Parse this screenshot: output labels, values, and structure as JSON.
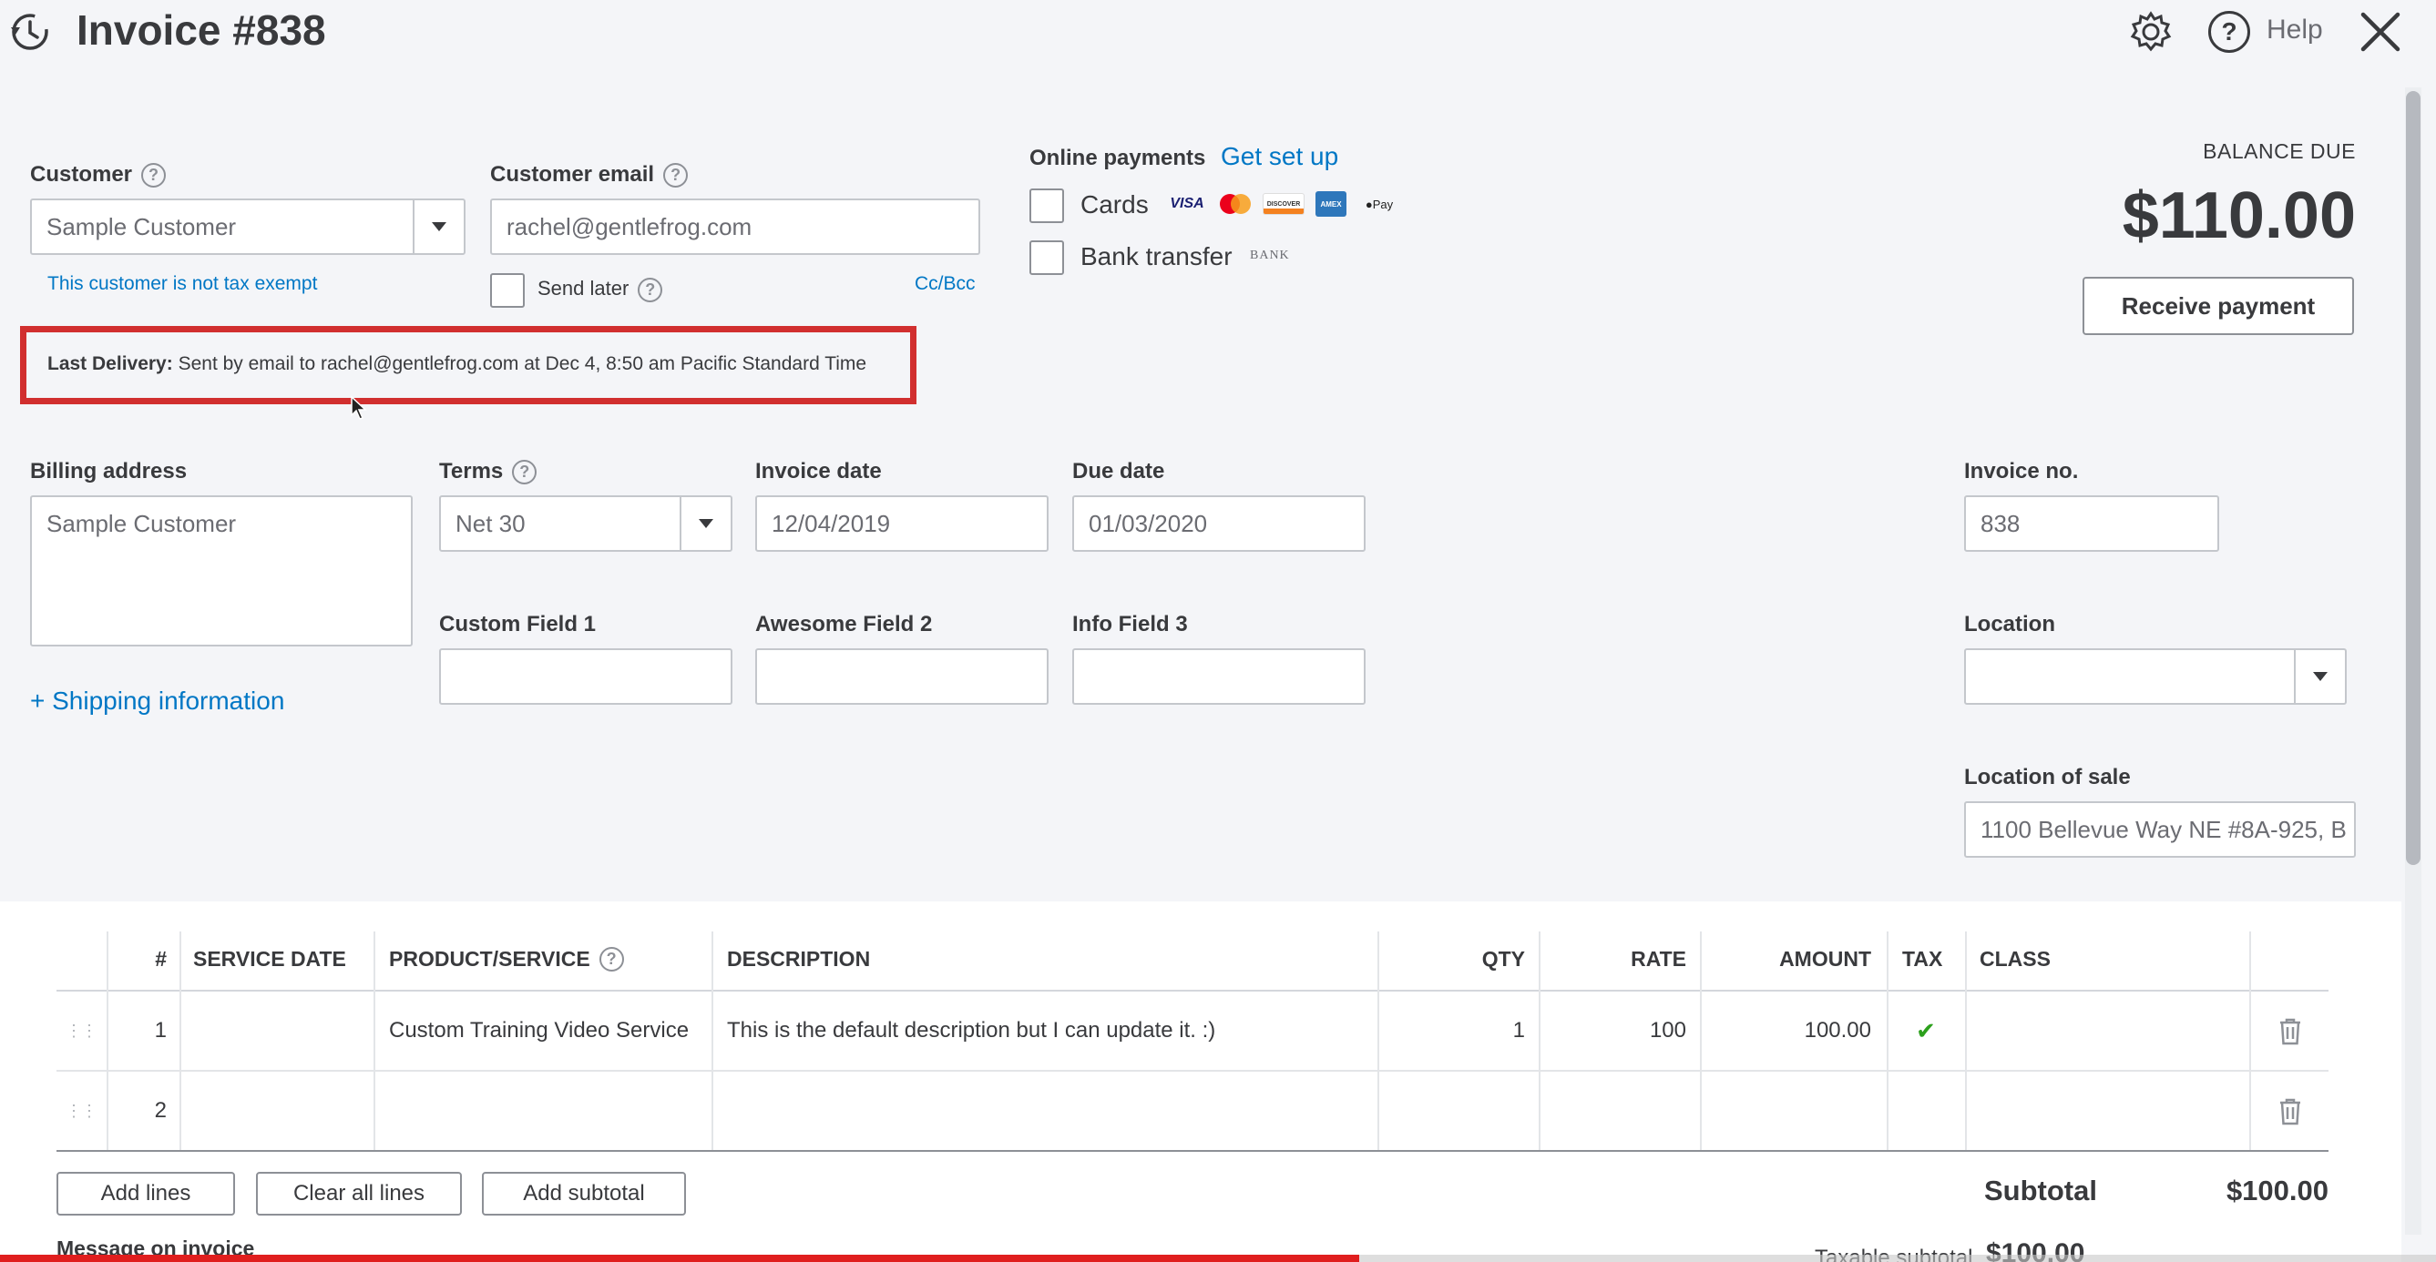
{
  "header": {
    "title": "Invoice #838",
    "help_label": "Help"
  },
  "customer": {
    "label": "Customer",
    "value": "Sample Customer",
    "tax_note": "This customer is not tax exempt"
  },
  "customer_email": {
    "label": "Customer email",
    "value": "rachel@gentlefrog.com",
    "send_later": "Send later",
    "cc_bcc": "Cc/Bcc"
  },
  "online_payments": {
    "label": "Online payments",
    "setup_link": "Get set up",
    "cards_label": "Cards",
    "bank_label": "Bank transfer",
    "bank_badge": "BANK",
    "card_icons": [
      "VISA",
      "mastercard",
      "DISCOVER",
      "AMEX",
      "Pay"
    ]
  },
  "balance": {
    "label": "BALANCE DUE",
    "amount": "$110.00",
    "receive_button": "Receive payment"
  },
  "last_delivery": {
    "prefix": "Last Delivery:",
    "text": "Sent by email to rachel@gentlefrog.com at Dec 4, 8:50 am Pacific Standard Time"
  },
  "billing": {
    "label": "Billing address",
    "value": "Sample Customer",
    "shipping_link": "+ Shipping information"
  },
  "terms": {
    "label": "Terms",
    "value": "Net 30"
  },
  "invoice_date": {
    "label": "Invoice date",
    "value": "12/04/2019"
  },
  "due_date": {
    "label": "Due date",
    "value": "01/03/2020"
  },
  "invoice_no": {
    "label": "Invoice no.",
    "value": "838"
  },
  "custom_fields": [
    {
      "label": "Custom Field 1",
      "value": ""
    },
    {
      "label": "Awesome Field 2",
      "value": ""
    },
    {
      "label": "Info Field 3",
      "value": ""
    }
  ],
  "location": {
    "label": "Location",
    "value": ""
  },
  "location_of_sale": {
    "label": "Location of sale",
    "value": "1100 Bellevue Way NE #8A-925, B"
  },
  "table": {
    "headers": {
      "num": "#",
      "service_date": "SERVICE DATE",
      "product": "PRODUCT/SERVICE",
      "description": "DESCRIPTION",
      "qty": "QTY",
      "rate": "RATE",
      "amount": "AMOUNT",
      "tax": "TAX",
      "class": "CLASS"
    },
    "rows": [
      {
        "num": "1",
        "service_date": "",
        "product": "Custom Training Video Service",
        "description": "This is the default description but I can update it. :)",
        "qty": "1",
        "rate": "100",
        "amount": "100.00",
        "tax": "✔",
        "class": ""
      },
      {
        "num": "2",
        "service_date": "",
        "product": "",
        "description": "",
        "qty": "",
        "rate": "",
        "amount": "",
        "tax": "",
        "class": ""
      }
    ]
  },
  "actions": {
    "add_lines": "Add lines",
    "clear_lines": "Clear all lines",
    "add_subtotal": "Add subtotal"
  },
  "totals": {
    "subtotal_label": "Subtotal",
    "subtotal_value": "$100.00",
    "taxable_label": "Taxable subtotal",
    "taxable_value": "$100.00"
  },
  "message_label": "Message on invoice",
  "colors": {
    "accent": "#0077c5",
    "highlight_box": "#d12f2f",
    "check": "#2ca01c",
    "progress": "#e01e1e"
  },
  "video_progress": 0.558
}
